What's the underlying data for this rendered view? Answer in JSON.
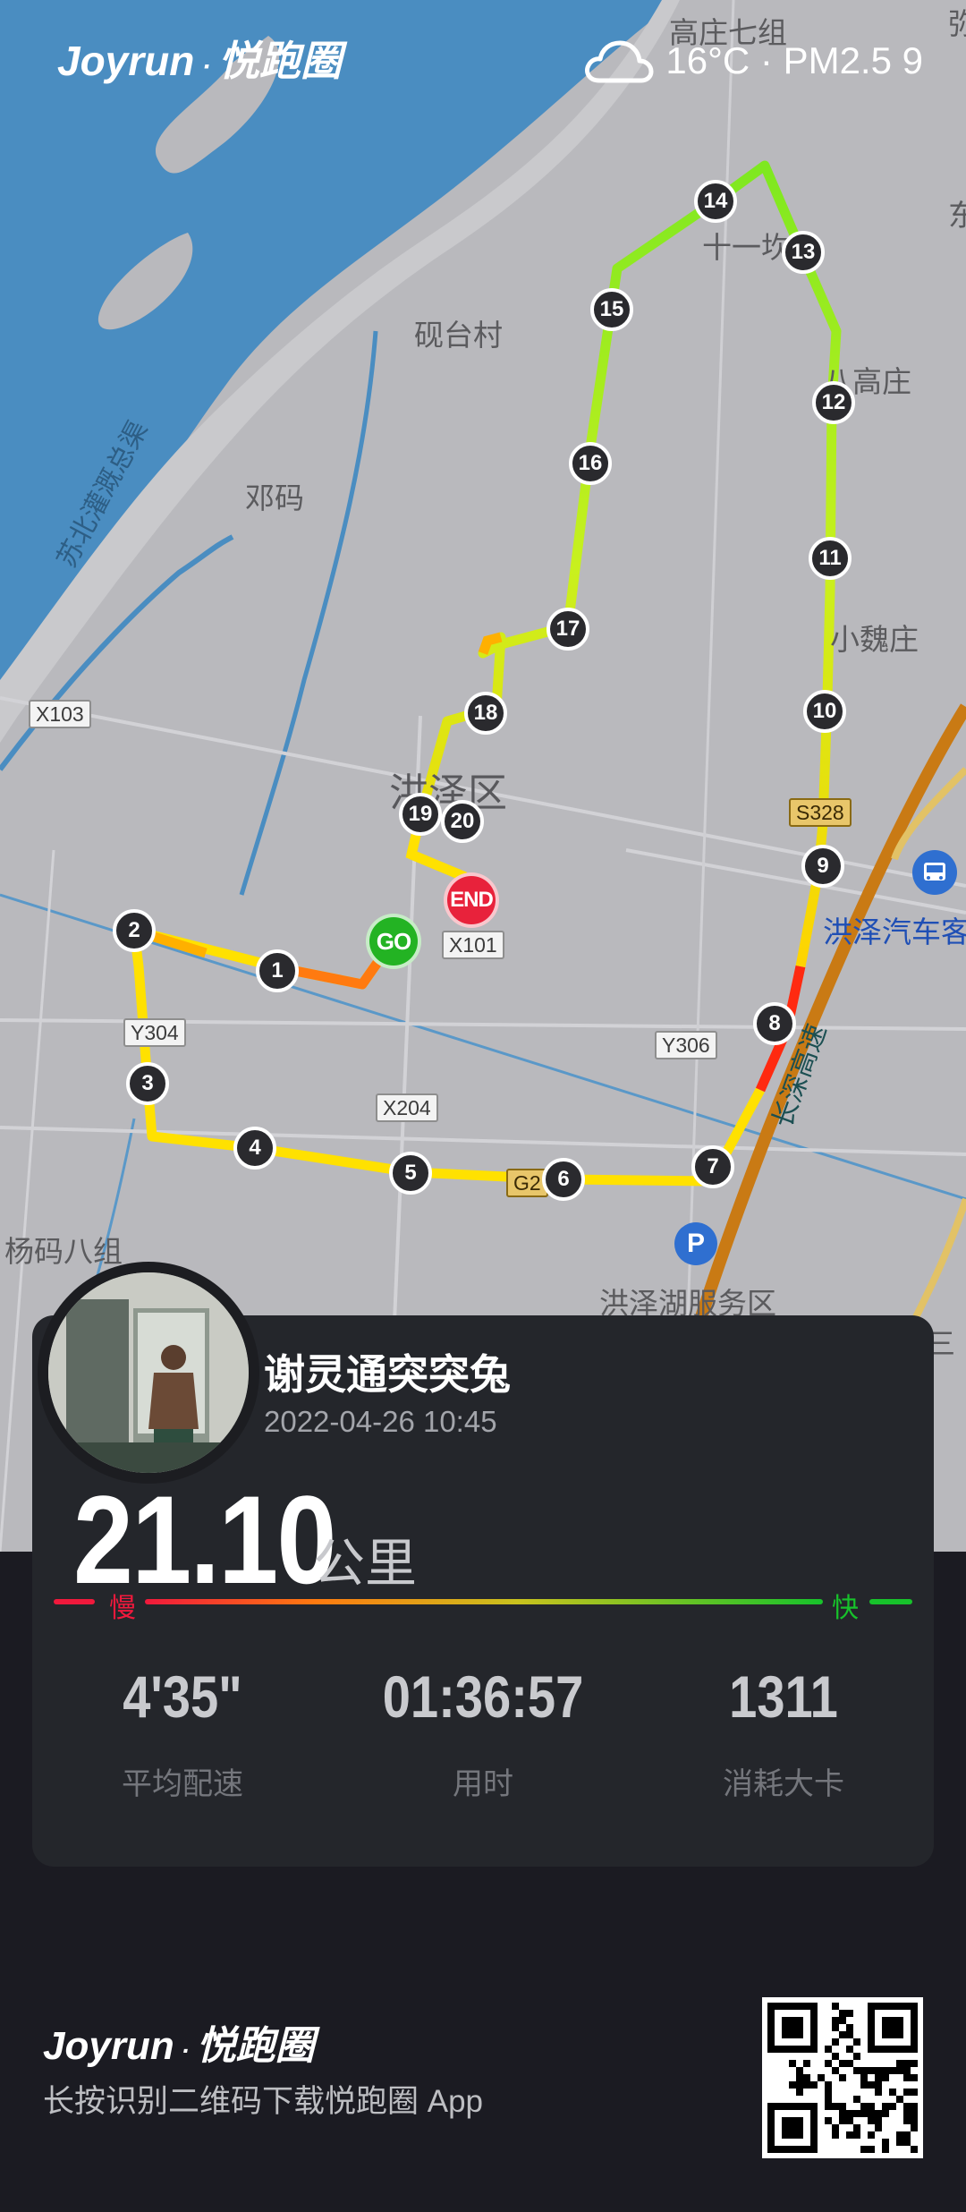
{
  "brand": {
    "name": "Joyrun",
    "sub": "悦跑圈"
  },
  "weather": {
    "icon": "cloud-icon",
    "text": "16°C · PM2.5 9"
  },
  "map": {
    "places": [
      "高庄七组",
      "十一坎",
      "砚台村",
      "八高庄",
      "邓码",
      "苏北灌溉总渠",
      "小魏庄",
      "洪泽区",
      "洪泽汽车客",
      "长深高速",
      "杨码八组",
      "洪泽湖服务区",
      "东",
      "弥",
      "三"
    ],
    "road_tags": [
      "X103",
      "S328",
      "X101",
      "Y304",
      "Y306",
      "X204",
      "G2"
    ],
    "markers": [
      "1",
      "2",
      "3",
      "4",
      "5",
      "6",
      "7",
      "8",
      "9",
      "10",
      "11",
      "12",
      "13",
      "14",
      "15",
      "16",
      "17",
      "18",
      "19",
      "20"
    ],
    "start_label": "GO",
    "end_label": "END"
  },
  "run": {
    "user": "谢灵通突突兔",
    "datetime": "2022-04-26 10:45",
    "distance": "21.10",
    "unit": "公里",
    "slow": "慢",
    "fast": "快",
    "stats": [
      {
        "value": "4'35\"",
        "label": "平均配速"
      },
      {
        "value": "01:36:57",
        "label": "用时"
      },
      {
        "value": "1311",
        "label": "消耗大卡"
      }
    ]
  },
  "footer": {
    "tagline": "长按识别二维码下载悦跑圈 App"
  },
  "colors": {
    "water": "#4a8dc1",
    "map_bg": "#b9b9bd",
    "card": "#24262b",
    "page": "#1b1b22",
    "start": "#23b323",
    "end": "#e8223b"
  }
}
